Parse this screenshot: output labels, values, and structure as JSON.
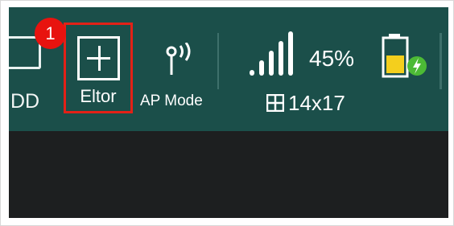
{
  "toolbar": {
    "dd_label": "DD",
    "editor_label": "Eltor",
    "ap_label": "AP Mode",
    "signal_strength": "45%",
    "grid_size": "14x17",
    "badge_number": "1"
  },
  "icons": {
    "device": "device-icon",
    "add": "add-icon",
    "ap": "wifi-antenna-icon",
    "signal": "signal-bars-icon",
    "grid": "grid-icon",
    "battery": "battery-charging-icon"
  },
  "colors": {
    "toolbar_bg": "#1b4f4a",
    "highlight": "#e32117",
    "badge": "#e8130f",
    "battery_fill": "#f4cf1d",
    "charging_bolt": "#4cba35"
  }
}
